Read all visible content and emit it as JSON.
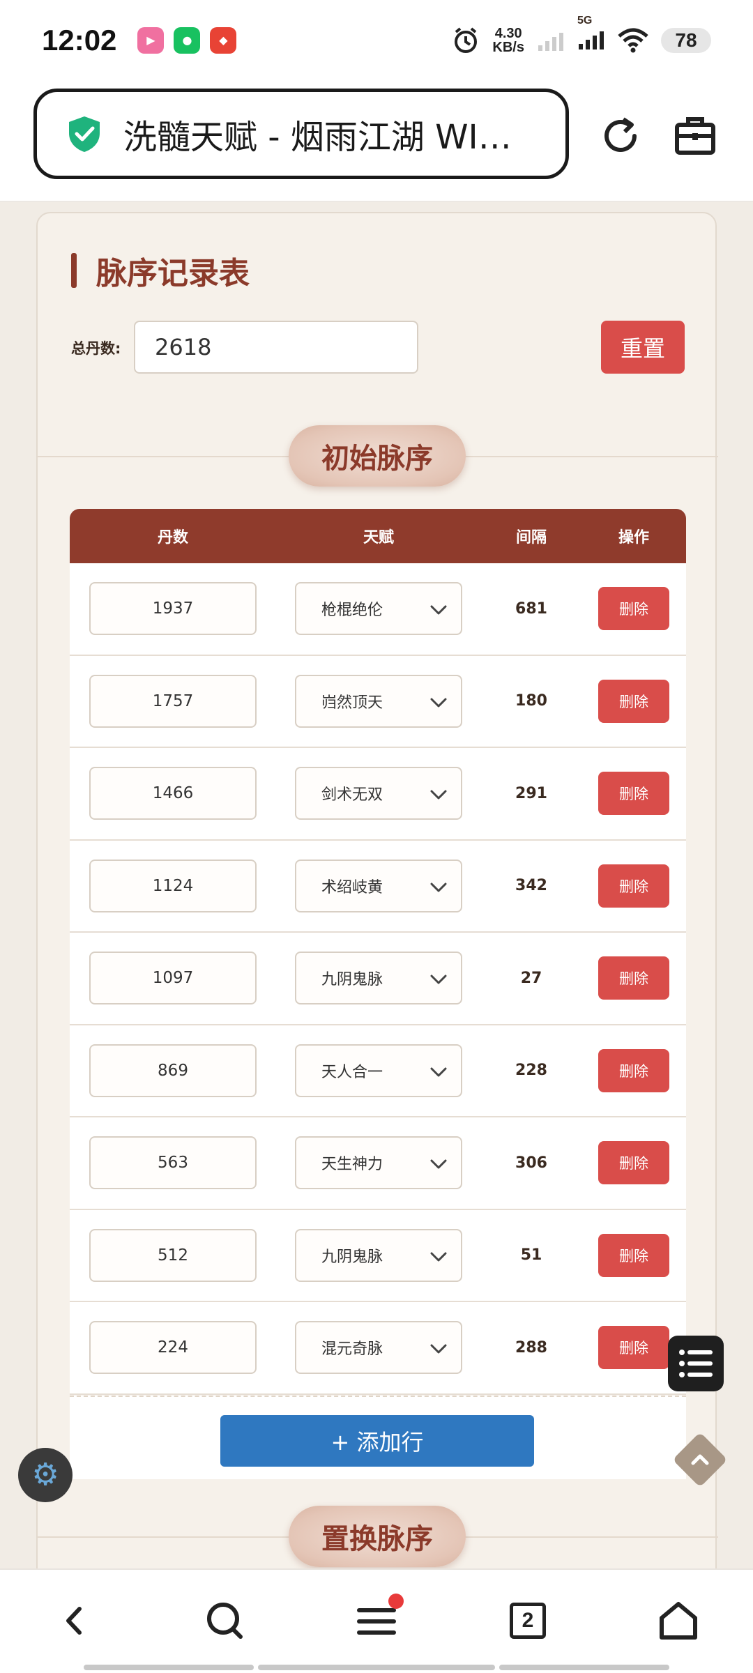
{
  "status_bar": {
    "time": "12:02",
    "app_icons": [
      "bilibili-icon",
      "wechat-icon",
      "xiaohongshu-icon"
    ],
    "speed_value": "4.30",
    "speed_unit": "KB/s",
    "network": "5G",
    "battery": "78"
  },
  "browser": {
    "url_title": "洗髓天赋 - 烟雨江湖 WIKI",
    "url_title_display": "洗髓天赋 - 烟雨江湖 WI…",
    "tab_count": "2"
  },
  "page": {
    "section_title": "脉序记录表",
    "total_label": "总丹数:",
    "total_value": "2618",
    "reset_label": "重置",
    "initial_pill": "初始脉序",
    "replace_pill": "置换脉序",
    "add_row_label": "+ 添加行",
    "delete_label": "删除",
    "columns": [
      "丹数",
      "天赋",
      "间隔",
      "操作"
    ],
    "rows": [
      {
        "dan": "1937",
        "talent": "枪棍绝伦",
        "interval": "681"
      },
      {
        "dan": "1757",
        "talent": "岿然顶天",
        "interval": "180"
      },
      {
        "dan": "1466",
        "talent": "剑术无双",
        "interval": "291"
      },
      {
        "dan": "1124",
        "talent": "术绍岐黄",
        "interval": "342"
      },
      {
        "dan": "1097",
        "talent": "九阴鬼脉",
        "interval": "27"
      },
      {
        "dan": "869",
        "talent": "天人合一",
        "interval": "228"
      },
      {
        "dan": "563",
        "talent": "天生神力",
        "interval": "306"
      },
      {
        "dan": "512",
        "talent": "九阴鬼脉",
        "interval": "51"
      },
      {
        "dan": "224",
        "talent": "混元奇脉",
        "interval": "288"
      }
    ]
  },
  "colors": {
    "brand_red": "#8f3b2c",
    "danger": "#d94d4a",
    "primary_blue": "#2f78c0"
  }
}
